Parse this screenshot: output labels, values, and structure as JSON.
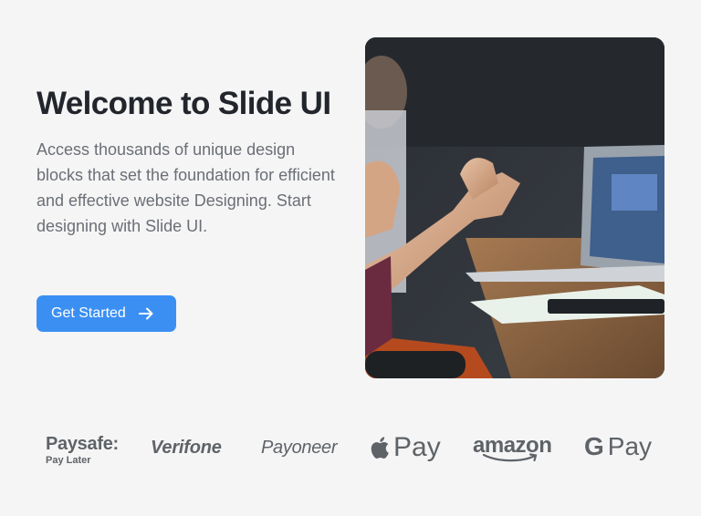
{
  "hero": {
    "title": "Welcome to Slide UI",
    "description": "Access thousands of unique design blocks that set the foundation for efficient and effective website Designing. Start designing with Slide UI.",
    "cta_label": "Get Started"
  },
  "logos": {
    "paysafe_main": "Paysafe:",
    "paysafe_sub": "Pay Later",
    "verifone": "Verifone",
    "payoneer": "Payoneer",
    "applepay": "Pay",
    "amazon": "amazon",
    "gpay_g": "G",
    "gpay": "Pay"
  },
  "colors": {
    "accent": "#3b8ff3",
    "background": "#f5f5f5",
    "logo_gray": "#5f6368"
  },
  "icons": {
    "cta": "arrow-right-icon",
    "applepay": "apple-icon",
    "amazon": "amazon-smile-icon"
  }
}
